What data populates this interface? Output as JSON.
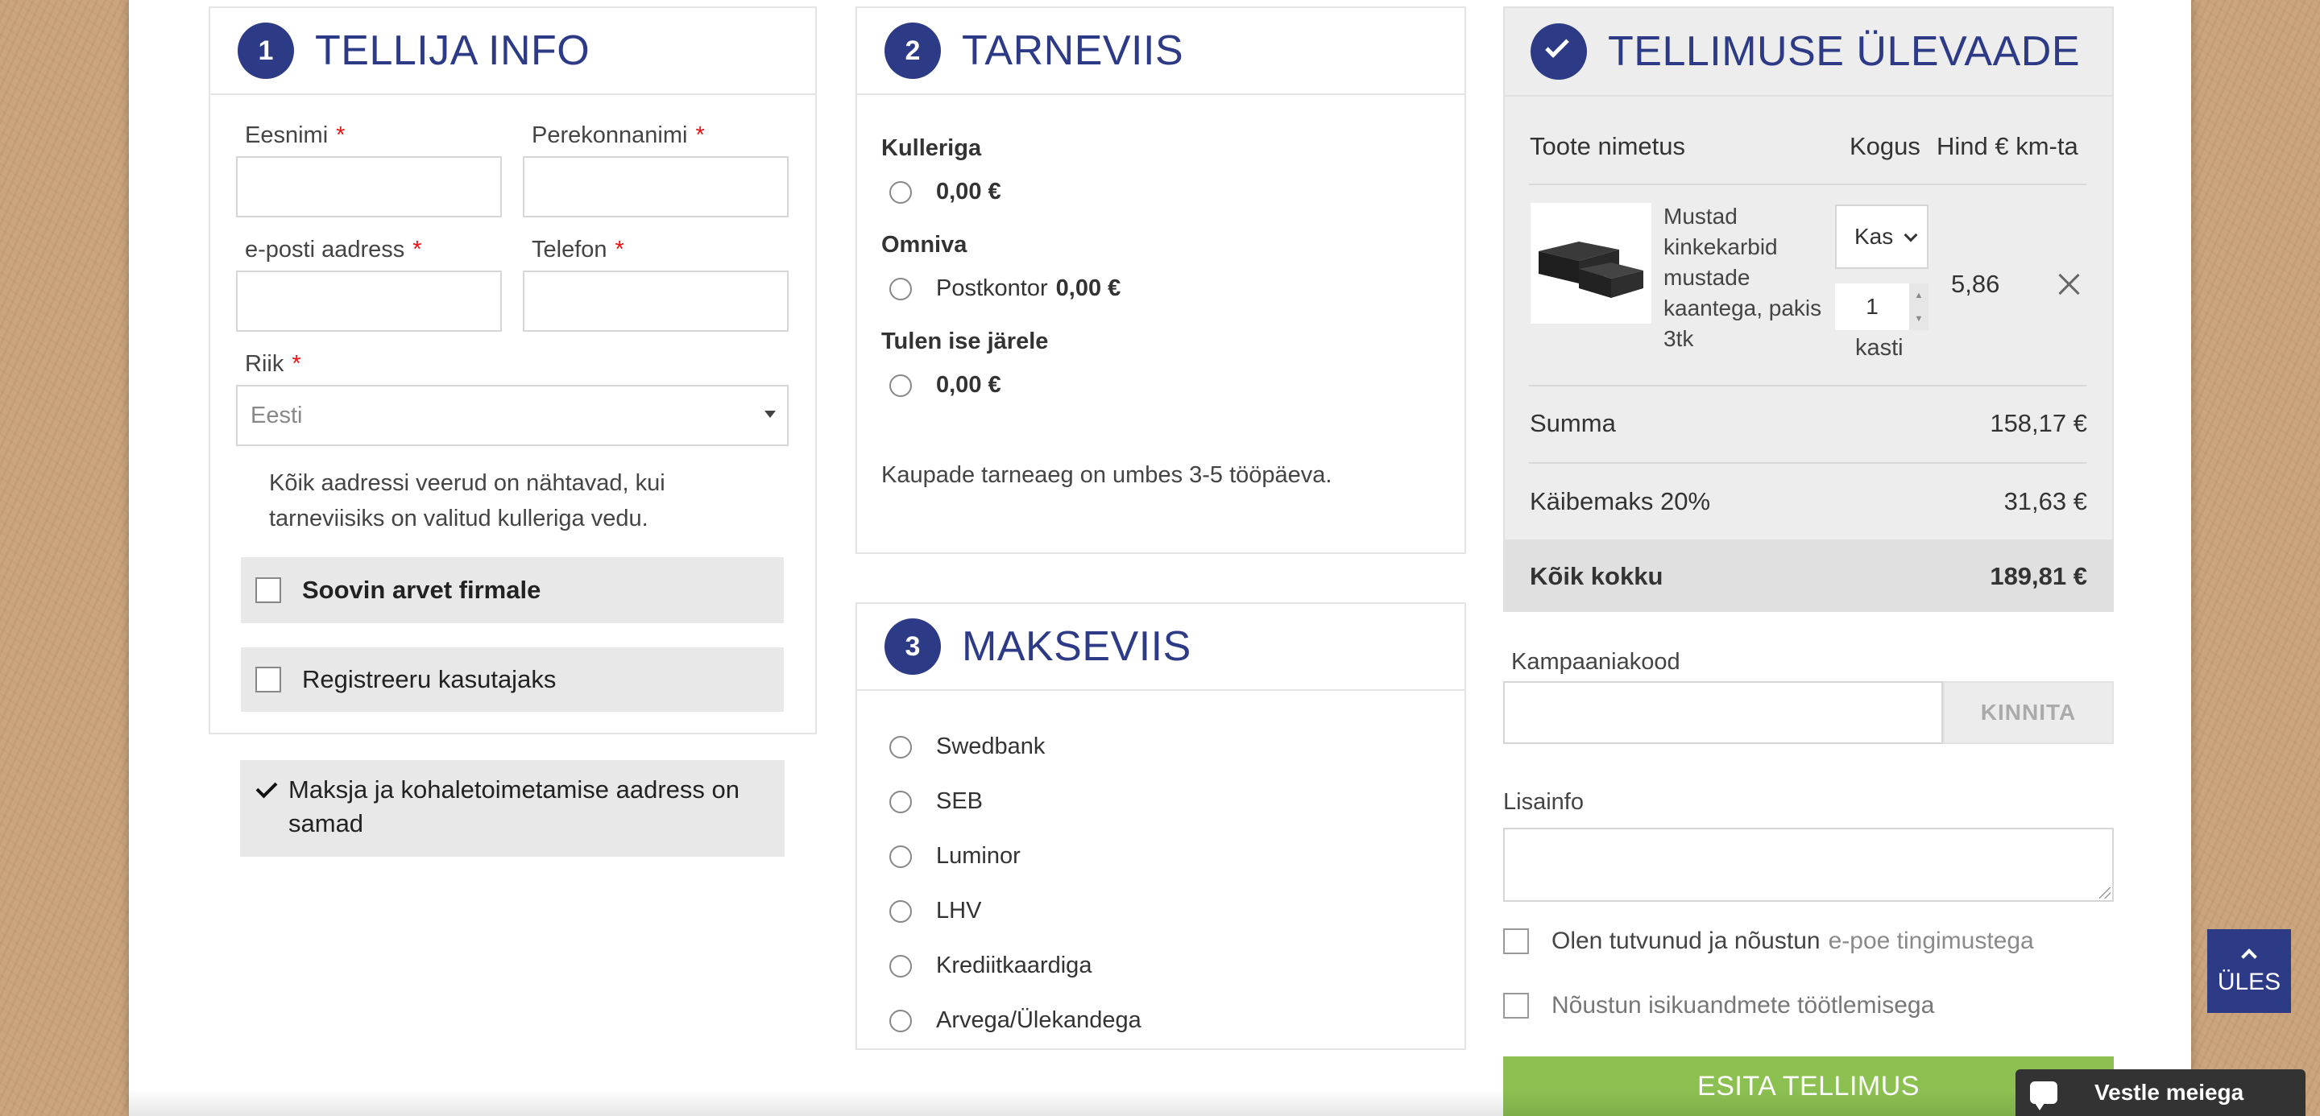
{
  "customer": {
    "step": "1",
    "title": "TELLIJA INFO",
    "first_name_label": "Eesnimi",
    "last_name_label": "Perekonnanimi",
    "email_label": "e-posti aadress",
    "phone_label": "Telefon",
    "country_label": "Riik",
    "country_value": "Eesti",
    "required_mark": "*",
    "address_note": "Kõik aadressi veerud on nähtavad, kui tarneviisiks on valitud kulleriga vedu.",
    "invoice_company_label": "Soovin arvet firmale",
    "register_label": "Registreeru kasutajaks",
    "same_address_label": "Maksja ja kohaletoimetamise aadress on samad"
  },
  "delivery": {
    "step": "2",
    "title": "TARNEVIIS",
    "courier_group": "Kulleriga",
    "courier_price": "0,00 €",
    "omniva_group": "Omniva",
    "omniva_option": "Postkontor",
    "omniva_price": "0,00 €",
    "pickup_group": "Tulen ise järele",
    "pickup_price": "0,00 €",
    "delivery_note": "Kaupade tarneaeg on umbes 3-5 tööpäeva."
  },
  "payment": {
    "step": "3",
    "title": "MAKSEVIIS",
    "options": [
      "Swedbank",
      "SEB",
      "Luminor",
      "LHV",
      "Krediitkaardiga",
      "Arvega/Ülekandega"
    ]
  },
  "summary": {
    "title": "TELLIMUSE ÜLEVAADE",
    "col_product": "Toote nimetus",
    "col_qty": "Kogus",
    "col_price": "Hind € km-ta",
    "item_name": "Mustad kinkekarbid mustade kaantega, pakis 3tk",
    "item_unit_select": "Kas",
    "item_qty": "1",
    "item_unit": "kasti",
    "item_price": "5,86",
    "subtotal_label": "Summa",
    "subtotal_value": "158,17 €",
    "vat_label": "Käibemaks 20%",
    "vat_value": "31,63 €",
    "total_label": "Kõik kokku",
    "total_value": "189,81 €"
  },
  "campaign": {
    "label": "Kampaaniakood",
    "confirm_button": "KINNITA"
  },
  "extra": {
    "label": "Lisainfo",
    "terms_prefix": "Olen tutvunud ja nõustun",
    "terms_link": "e-poe tingimustega",
    "privacy_label": "Nõustun isikuandmete töötlemisega",
    "submit_button": "ESITA TELLIMUS"
  },
  "widgets": {
    "up_button": "ÜLES",
    "chat_label": "Vestle meiega"
  },
  "colors": {
    "accent": "#2d3b86",
    "submit": "#8cc152",
    "required": "#e11111",
    "link_gray": "#8a8a8a"
  }
}
